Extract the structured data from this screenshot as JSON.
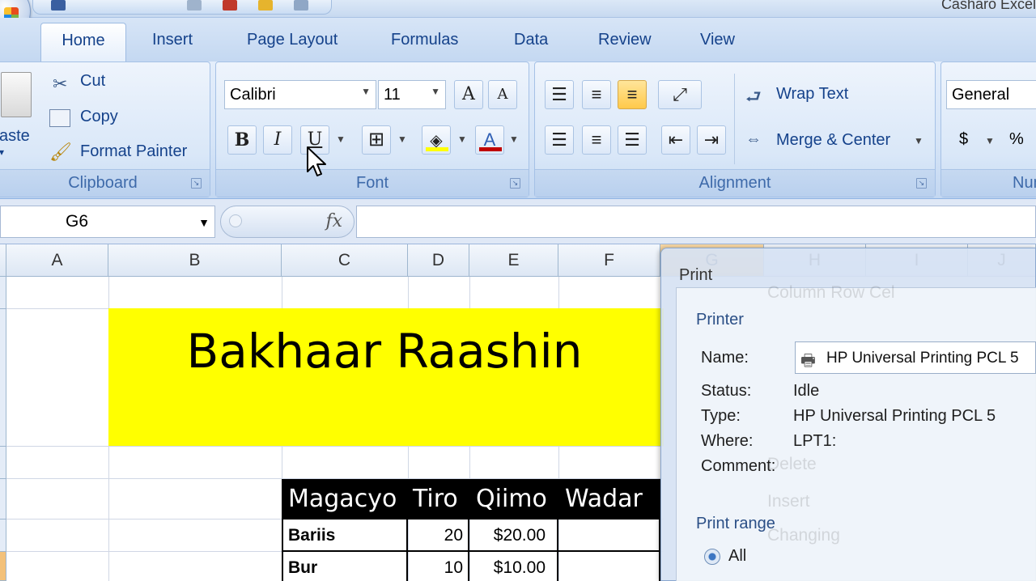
{
  "window": {
    "title": "Casharo Excel"
  },
  "tabs": [
    "Home",
    "Insert",
    "Page Layout",
    "Formulas",
    "Data",
    "Review",
    "View"
  ],
  "active_tab": "Home",
  "clipboard": {
    "paste": "aste",
    "cut": "Cut",
    "copy": "Copy",
    "format_painter": "Format Painter",
    "label": "Clipboard"
  },
  "font": {
    "name": "Calibri",
    "size": "11",
    "label": "Font",
    "grow": "A",
    "shrink": "A",
    "bold": "B",
    "italic": "I",
    "underline": "U",
    "font_color": "A"
  },
  "alignment": {
    "wrap_text": "Wrap Text",
    "merge_center": "Merge & Center",
    "label": "Alignment"
  },
  "number": {
    "format": "General",
    "currency": "$",
    "percent": "%",
    "label": "Num"
  },
  "formula_bar": {
    "cell_ref": "G6",
    "fx": "fx"
  },
  "columns": [
    "A",
    "B",
    "C",
    "D",
    "E",
    "F",
    "G",
    "H",
    "I",
    "J"
  ],
  "sheet": {
    "title": "Bakhaar Raashin",
    "table": {
      "headers": [
        "Magacyo",
        "Tiro",
        "Qiimo",
        "Wadar"
      ],
      "rows": [
        [
          "Bariis",
          "20",
          "$20.00",
          ""
        ],
        [
          "Bur",
          "10",
          "$10.00",
          ""
        ]
      ]
    }
  },
  "print_dialog": {
    "title": "Print",
    "printer_section": "Printer",
    "name_label": "Name:",
    "name_value": "HP Universal Printing PCL 5",
    "status_label": "Status:",
    "status_value": "Idle",
    "type_label": "Type:",
    "type_value": "HP Universal Printing PCL 5",
    "where_label": "Where:",
    "where_value": "LPT1:",
    "comment_label": "Comment:",
    "print_range": "Print range",
    "all": "All",
    "ghost_texts": [
      "Column Row Cel",
      "Delete",
      "Insert",
      "Changing"
    ]
  }
}
